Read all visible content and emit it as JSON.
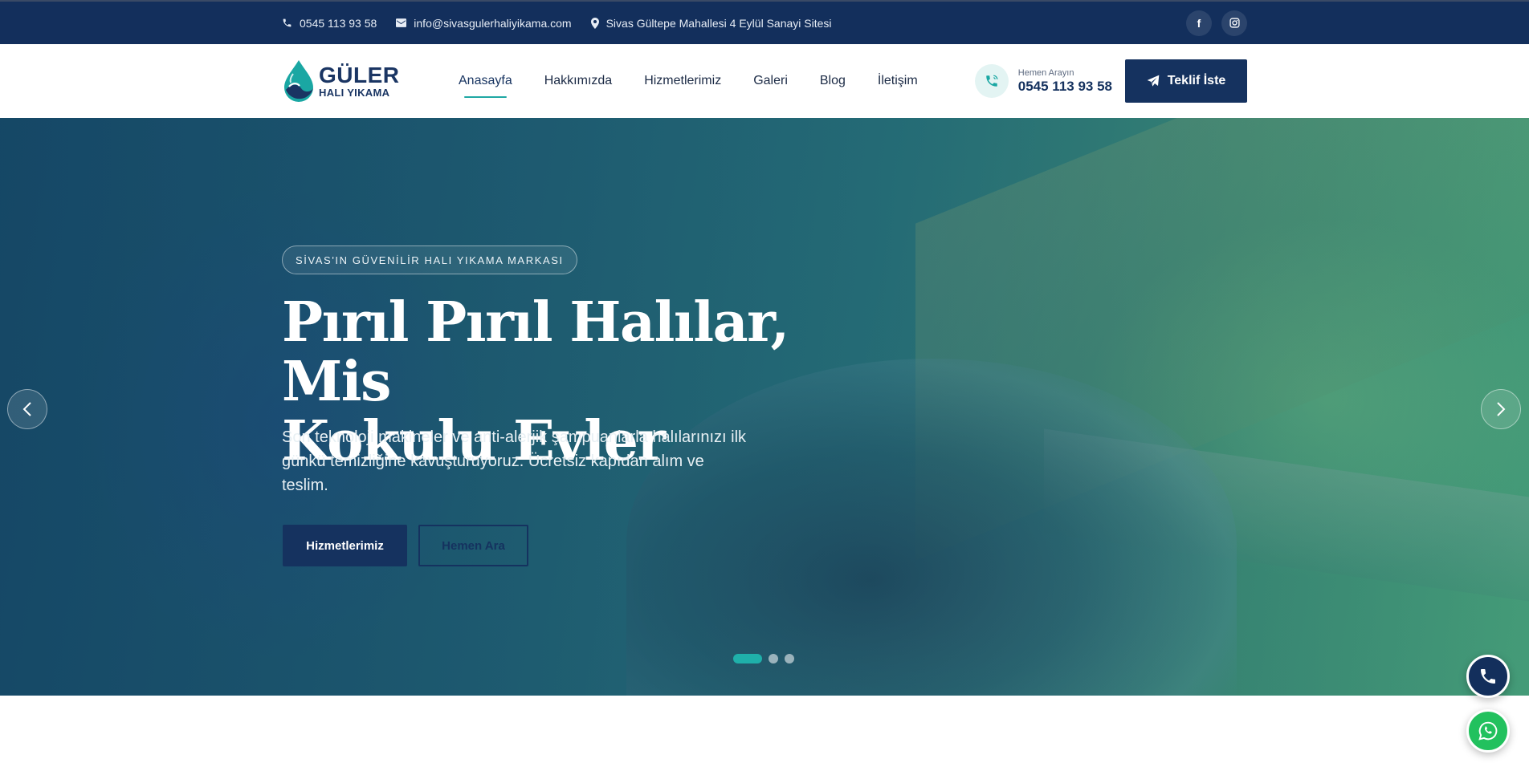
{
  "topbar": {
    "phone": "0545 113 93 58",
    "email": "info@sivasgulerhaliyikama.com",
    "address": "Sivas Gültepe Mahallesi 4 Eylül Sanayi Sitesi",
    "social": {
      "facebook": "f",
      "instagram": "instagram-icon"
    }
  },
  "header": {
    "logo": {
      "name": "GÜLER",
      "sub": "HALI YIKAMA"
    },
    "nav": [
      {
        "label": "Anasayfa",
        "active": true
      },
      {
        "label": "Hakkımızda"
      },
      {
        "label": "Hizmetlerimiz"
      },
      {
        "label": "Galeri"
      },
      {
        "label": "Blog"
      },
      {
        "label": "İletişim"
      }
    ],
    "call": {
      "label": "Hemen Arayın",
      "number": "0545 113 93 58"
    },
    "quote_button": "Teklif İste"
  },
  "hero": {
    "tag": "SİVAS'IN GÜVENİLİR HALI YIKAMA MARKASI",
    "headline_line1": "Pırıl Pırıl Halılar, Mis",
    "headline_line2": "Kokulu Evler",
    "subtext": "Son teknoloji makineler ve anti-alerjik şampuanlarla halılarınızı ilk günkü temizliğine kavuşturuyoruz. Ücretsiz kapıdan alım ve teslim.",
    "button_primary": "Hizmetlerimiz",
    "button_secondary": "Hemen Ara",
    "slides": 3,
    "active_slide": 1
  },
  "colors": {
    "navy": "#15325f",
    "teal": "#1fa8a4",
    "whatsapp": "#22c15e"
  }
}
